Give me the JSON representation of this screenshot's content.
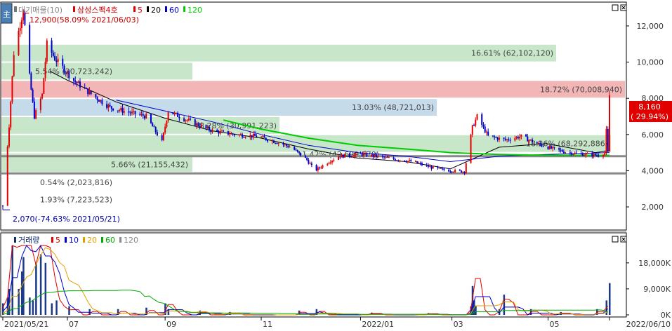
{
  "chart_data": [
    {
      "type": "candlestick",
      "title": "삼성스팩4호",
      "legend": {
        "label": "대기매물(10)",
        "items": [
          {
            "name": "5",
            "color": "#e00000"
          },
          {
            "name": "20",
            "color": "#000000"
          },
          {
            "name": "60",
            "color": "#0000cc"
          },
          {
            "name": "120",
            "color": "#00cc00"
          }
        ]
      },
      "y_ticks": [
        {
          "v": 2000,
          "label": "2,000"
        },
        {
          "v": 4000,
          "label": "4,000"
        },
        {
          "v": 6000,
          "label": "6,000"
        },
        {
          "v": 8000,
          "label": "8,000"
        },
        {
          "v": 10000,
          "label": "10,000"
        },
        {
          "v": 12000,
          "label": "12,000"
        }
      ],
      "ylim": [
        800,
        13200
      ],
      "x_ticks": [
        {
          "date": "2021-05-21",
          "label": "2021/05/21"
        },
        {
          "date": "2021-07-01",
          "label": "07"
        },
        {
          "date": "2021-09-01",
          "label": "09"
        },
        {
          "date": "2021-11-01",
          "label": "11"
        },
        {
          "date": "2022-01-03",
          "label": "2022/01"
        },
        {
          "date": "2022-03-02",
          "label": "03"
        },
        {
          "date": "2022-05-02",
          "label": "05"
        },
        {
          "date": "2022-06-10",
          "label": "2022/06/10"
        }
      ],
      "date_range": [
        "2021-05-21",
        "2022-06-10"
      ],
      "volume_profile": [
        {
          "from": 10000,
          "to": 11000,
          "label": "16.61% (62,102,120)",
          "color": "#c8e6c9"
        },
        {
          "from": 9000,
          "to": 10000,
          "label": "5.54% (20,723,242)",
          "color": "#c8e6c9"
        },
        {
          "from": 8000,
          "to": 9000,
          "label": "18.72% (70,008,940)",
          "color": "#f2b6b6"
        },
        {
          "from": 7000,
          "to": 8000,
          "label": "13.03% (48,721,013)",
          "color": "#c5dbea"
        },
        {
          "from": 6000,
          "to": 7000,
          "label": "8.28% (30,991,223)",
          "color": "#c8e6c9"
        },
        {
          "from": 5000,
          "to": 6000,
          "label": "18.26% (68,292,886)",
          "color": "#c8e6c9"
        },
        {
          "from": 4800,
          "to": 5000,
          "label": "11.42% (42,699,579)",
          "color": "#c8e6c9"
        },
        {
          "from": 3900,
          "to": 4800,
          "label": "5.66% (21,155,432)",
          "color": "#c8e6c9"
        },
        {
          "from": 2900,
          "to": 3800,
          "label": "0.54% (2,023,816)",
          "color": "none"
        },
        {
          "from": 1900,
          "to": 2900,
          "label": "1.93% (7,223,523)",
          "color": "none"
        }
      ],
      "annotations": {
        "high": {
          "value": 12900,
          "date": "2021-06-03",
          "label": "12,900(58.09% 2021/06/03)"
        },
        "low": {
          "value": 2070,
          "date": "2021-05-21",
          "label": "2,070(-74.63% 2021/05/21)"
        },
        "last_price": {
          "value": 8160,
          "label": "8,160",
          "change": "( 29.94%)"
        }
      },
      "price_path": [
        [
          "2021-05-21",
          2070
        ],
        [
          "2021-05-25",
          6500
        ],
        [
          "2021-05-28",
          10500
        ],
        [
          "2021-06-03",
          12900
        ],
        [
          "2021-06-07",
          9200
        ],
        [
          "2021-06-10",
          7000
        ],
        [
          "2021-06-15",
          8200
        ],
        [
          "2021-06-18",
          11000
        ],
        [
          "2021-06-23",
          10200
        ],
        [
          "2021-06-28",
          9700
        ],
        [
          "2021-07-05",
          9000
        ],
        [
          "2021-07-15",
          8300
        ],
        [
          "2021-07-28",
          7500
        ],
        [
          "2021-08-10",
          7200
        ],
        [
          "2021-08-20",
          7000
        ],
        [
          "2021-08-30",
          5600
        ],
        [
          "2021-09-03",
          7300
        ],
        [
          "2021-09-10",
          7000
        ],
        [
          "2021-09-20",
          6600
        ],
        [
          "2021-10-01",
          6200
        ],
        [
          "2021-10-15",
          6000
        ],
        [
          "2021-10-29",
          5900
        ],
        [
          "2021-11-10",
          5600
        ],
        [
          "2021-11-20",
          5300
        ],
        [
          "2021-11-30",
          4600
        ],
        [
          "2021-12-05",
          4000
        ],
        [
          "2021-12-12",
          4400
        ],
        [
          "2021-12-20",
          4800
        ],
        [
          "2022-01-04",
          4900
        ],
        [
          "2022-01-20",
          4700
        ],
        [
          "2022-02-05",
          4500
        ],
        [
          "2022-02-20",
          4100
        ],
        [
          "2022-03-02",
          4000
        ],
        [
          "2022-03-10",
          3950
        ],
        [
          "2022-03-15",
          6400
        ],
        [
          "2022-03-18",
          7000
        ],
        [
          "2022-03-25",
          5900
        ],
        [
          "2022-04-05",
          5700
        ],
        [
          "2022-04-15",
          5900
        ],
        [
          "2022-04-25",
          5500
        ],
        [
          "2022-05-05",
          5200
        ],
        [
          "2022-05-15",
          5000
        ],
        [
          "2022-05-25",
          4900
        ],
        [
          "2022-06-03",
          4850
        ],
        [
          "2022-06-07",
          5000
        ],
        [
          "2022-06-08",
          6200
        ],
        [
          "2022-06-09",
          5000
        ],
        [
          "2022-06-10",
          8160
        ]
      ],
      "ma_lines": [
        {
          "name": "20",
          "color": "#000000",
          "points": [
            [
              "2021-06-20",
              9500
            ],
            [
              "2021-07-01",
              9000
            ],
            [
              "2021-08-01",
              7800
            ],
            [
              "2021-09-01",
              6900
            ],
            [
              "2021-10-01",
              6200
            ],
            [
              "2021-11-01",
              5800
            ],
            [
              "2021-12-01",
              5200
            ],
            [
              "2022-01-01",
              4700
            ],
            [
              "2022-02-01",
              4500
            ],
            [
              "2022-03-01",
              4100
            ],
            [
              "2022-04-01",
              5300
            ],
            [
              "2022-05-01",
              5500
            ],
            [
              "2022-06-01",
              5000
            ],
            [
              "2022-06-10",
              5100
            ]
          ]
        },
        {
          "name": "60",
          "color": "#0000cc",
          "points": [
            [
              "2021-08-01",
              7900
            ],
            [
              "2021-09-01",
              7300
            ],
            [
              "2021-10-01",
              6700
            ],
            [
              "2021-11-01",
              6000
            ],
            [
              "2021-12-01",
              5400
            ],
            [
              "2022-01-01",
              5000
            ],
            [
              "2022-02-01",
              4800
            ],
            [
              "2022-03-01",
              4500
            ],
            [
              "2022-04-01",
              4800
            ],
            [
              "2022-05-01",
              4900
            ],
            [
              "2022-06-10",
              5000
            ]
          ]
        },
        {
          "name": "120",
          "color": "#00cc00",
          "points": [
            [
              "2021-10-08",
              6800
            ],
            [
              "2021-11-01",
              6300
            ],
            [
              "2021-12-01",
              5800
            ],
            [
              "2022-01-01",
              5400
            ],
            [
              "2022-02-01",
              5200
            ],
            [
              "2022-03-01",
              5000
            ],
            [
              "2022-04-01",
              4900
            ],
            [
              "2022-05-01",
              4850
            ],
            [
              "2022-06-10",
              4850
            ]
          ]
        }
      ]
    },
    {
      "type": "bar",
      "title": "거래량",
      "legend": {
        "items": [
          {
            "name": "5",
            "color": "#e00000"
          },
          {
            "name": "10",
            "color": "#0000cc"
          },
          {
            "name": "20",
            "color": "#e0a000"
          },
          {
            "name": "60",
            "color": "#00aa00"
          },
          {
            "name": "120",
            "color": "#888888"
          }
        ]
      },
      "y_ticks": [
        {
          "v": 0,
          "label": "0K"
        },
        {
          "v": 9000,
          "label": "9,000K"
        },
        {
          "v": 18000,
          "label": "18,000K"
        }
      ],
      "ylim": [
        0,
        25000
      ],
      "volumes_k": [
        [
          "2021-05-21",
          4000
        ],
        [
          "2021-05-24",
          6000
        ],
        [
          "2021-05-25",
          9000
        ],
        [
          "2021-05-27",
          24000
        ],
        [
          "2021-05-31",
          9000
        ],
        [
          "2021-06-02",
          15000
        ],
        [
          "2021-06-03",
          20000
        ],
        [
          "2021-06-07",
          6000
        ],
        [
          "2021-06-09",
          5000
        ],
        [
          "2021-06-11",
          18000
        ],
        [
          "2021-06-14",
          21000
        ],
        [
          "2021-06-17",
          18000
        ],
        [
          "2021-06-21",
          4000
        ],
        [
          "2021-06-24",
          5000
        ],
        [
          "2021-07-02",
          3000
        ],
        [
          "2021-07-15",
          2000
        ],
        [
          "2021-08-02",
          2000
        ],
        [
          "2021-08-20",
          2500
        ],
        [
          "2021-09-01",
          4000
        ],
        [
          "2021-09-03",
          2000
        ],
        [
          "2021-09-23",
          1500
        ],
        [
          "2021-10-12",
          1000
        ],
        [
          "2021-11-25",
          1500
        ],
        [
          "2021-12-06",
          2000
        ],
        [
          "2022-01-10",
          800
        ],
        [
          "2022-02-15",
          600
        ],
        [
          "2022-03-14",
          3000
        ],
        [
          "2022-03-15",
          10000
        ],
        [
          "2022-03-16",
          5000
        ],
        [
          "2022-03-17",
          3000
        ],
        [
          "2022-04-01",
          2000
        ],
        [
          "2022-04-04",
          7000
        ],
        [
          "2022-04-21",
          2000
        ],
        [
          "2022-05-10",
          1000
        ],
        [
          "2022-06-02",
          2000
        ],
        [
          "2022-06-08",
          5000
        ],
        [
          "2022-06-10",
          11000
        ]
      ]
    }
  ]
}
